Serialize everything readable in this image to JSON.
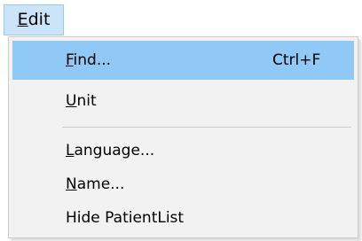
{
  "menubar": {
    "edit": {
      "mnemonic": "E",
      "rest": "dit"
    }
  },
  "menu": {
    "items": [
      {
        "mnemonic": "F",
        "rest": "ind...",
        "shortcut": "Ctrl+F"
      },
      {
        "mnemonic": "U",
        "rest": "nit"
      },
      {
        "mnemonic": "L",
        "rest": "anguage..."
      },
      {
        "mnemonic": "N",
        "rest": "ame..."
      },
      {
        "label": "Hide PatientList"
      }
    ]
  },
  "colors": {
    "highlight": "#90c8f6",
    "menubar_active": "#cce4f7",
    "menu_background": "#f2f2f2"
  }
}
